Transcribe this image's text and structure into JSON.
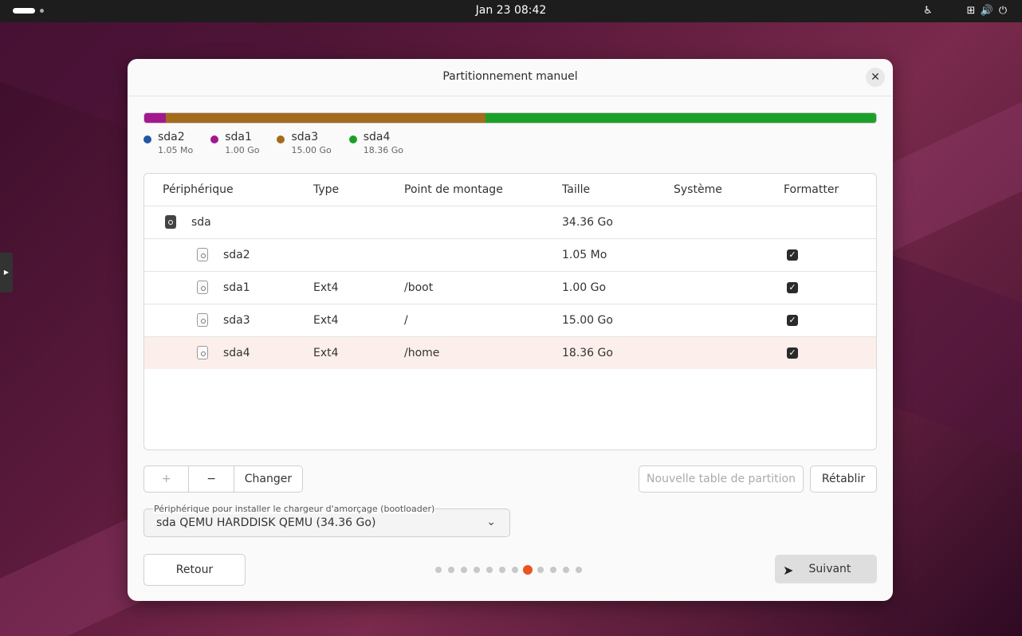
{
  "topbar": {
    "clock": "Jan 23  08:42"
  },
  "dialog": {
    "title": "Partitionnement manuel",
    "close_icon": "✕"
  },
  "disk_usage": {
    "segments": [
      {
        "name": "sda2",
        "fraction": 3e-05,
        "color": "#2455a6"
      },
      {
        "name": "sda1",
        "fraction": 0.029,
        "color": "#a3188e"
      },
      {
        "name": "sda3",
        "fraction": 0.437,
        "color": "#a46b1c"
      },
      {
        "name": "sda4",
        "fraction": 0.534,
        "color": "#1ba12a"
      }
    ],
    "legend": [
      {
        "name": "sda2",
        "size": "1.05 Mo",
        "color": "#2455a6"
      },
      {
        "name": "sda1",
        "size": "1.00 Go",
        "color": "#a3188e"
      },
      {
        "name": "sda3",
        "size": "15.00 Go",
        "color": "#a46b1c"
      },
      {
        "name": "sda4",
        "size": "18.36 Go",
        "color": "#1ba12a"
      }
    ]
  },
  "table": {
    "headers": [
      "Périphérique",
      "Type",
      "Point de montage",
      "Taille",
      "Système",
      "Formatter"
    ],
    "rows": [
      {
        "device": "sda",
        "type": "",
        "mount": "",
        "size": "34.36 Go",
        "system": "",
        "format": null
      },
      {
        "device": "sda2",
        "type": "",
        "mount": "",
        "size": "1.05 Mo",
        "system": "",
        "format": true
      },
      {
        "device": "sda1",
        "type": "Ext4",
        "mount": "/boot",
        "size": "1.00 Go",
        "system": "",
        "format": true
      },
      {
        "device": "sda3",
        "type": "Ext4",
        "mount": "/",
        "size": "15.00 Go",
        "system": "",
        "format": true
      },
      {
        "device": "sda4",
        "type": "Ext4",
        "mount": "/home",
        "size": "18.36 Go",
        "system": "",
        "format": true
      }
    ]
  },
  "actions": {
    "add": "+",
    "remove": "−",
    "change": "Changer",
    "new_table": "Nouvelle table de partition",
    "revert": "Rétablir"
  },
  "bootloader": {
    "label": "Périphérique pour installer le chargeur d'amorçage (bootloader)",
    "value": "sda QEMU HARDDISK QEMU (34.36 Go)"
  },
  "nav": {
    "back": "Retour",
    "next": "Suivant",
    "steps_total": 12,
    "current_step": 8
  },
  "colors": {
    "accent": "#e95420"
  }
}
